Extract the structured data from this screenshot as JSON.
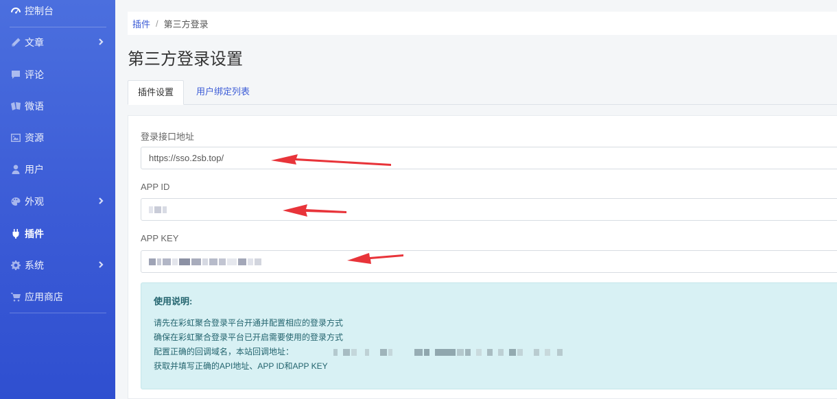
{
  "sidebar": {
    "items": [
      {
        "label": "控制台",
        "icon": "gauge-icon"
      },
      {
        "label": "文章",
        "icon": "pencil-icon",
        "has_submenu": true
      },
      {
        "label": "评论",
        "icon": "comment-icon"
      },
      {
        "label": "微语",
        "icon": "message-icon"
      },
      {
        "label": "资源",
        "icon": "image-icon"
      },
      {
        "label": "用户",
        "icon": "user-icon"
      },
      {
        "label": "外观",
        "icon": "paint-icon",
        "has_submenu": true
      },
      {
        "label": "插件",
        "icon": "plug-icon",
        "active": true
      },
      {
        "label": "系统",
        "icon": "gear-icon",
        "has_submenu": true
      },
      {
        "label": "应用商店",
        "icon": "cart-icon"
      }
    ]
  },
  "breadcrumb": {
    "parent": "插件",
    "separator": "/",
    "current": "第三方登录"
  },
  "page": {
    "title": "第三方登录设置"
  },
  "tabs": [
    {
      "label": "插件设置",
      "active": true
    },
    {
      "label": "用户绑定列表",
      "active": false
    }
  ],
  "form": {
    "login_url": {
      "label": "登录接口地址",
      "value": "https://sso.2sb.top/"
    },
    "app_id": {
      "label": "APP ID",
      "value": "(blurred)"
    },
    "app_key": {
      "label": "APP KEY",
      "value": "(blurred)"
    }
  },
  "notice": {
    "title": "使用说明:",
    "lines": [
      "请先在彩虹聚合登录平台开通并配置相应的登录方式",
      "确保在彩虹聚合登录平台已开启需要使用的登录方式",
      "配置正确的回调域名，本站回调地址：",
      "获取并填写正确的API地址、APP ID和APP KEY"
    ]
  },
  "colors": {
    "accent": "#3b5bd6",
    "annotation_arrow": "#e8343a",
    "notice_bg": "#d8f1f4"
  }
}
